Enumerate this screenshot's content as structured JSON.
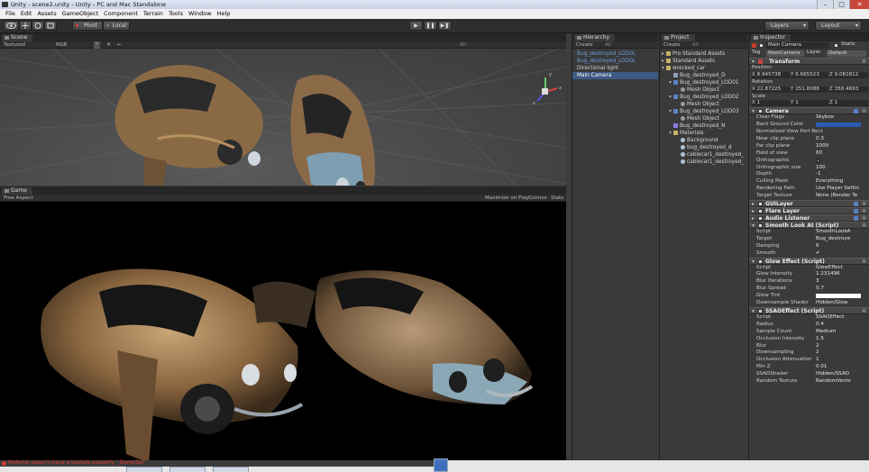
{
  "window": {
    "title": "Unity - scene2.unity - Unity - PC and Mac Standalone",
    "controls": [
      "–",
      "□",
      "✕"
    ]
  },
  "menu": [
    "File",
    "Edit",
    "Assets",
    "GameObject",
    "Component",
    "Terrain",
    "Tools",
    "Window",
    "Help"
  ],
  "toolbar": {
    "pivot": "Pivot",
    "local": "Local",
    "layers": "Layers",
    "layout": "Layout",
    "play_icons": [
      "▶",
      "❚❚",
      "▶❚"
    ]
  },
  "scene": {
    "tab": "Scene",
    "textured": "Textured",
    "rgb": "RGB",
    "gizmo_labels": [
      "*",
      "☀",
      "←"
    ],
    "search": "All",
    "axis_labels": [
      "y",
      "x",
      "z"
    ]
  },
  "game": {
    "tab": "Game",
    "aspect": "Free Aspect",
    "options": [
      "Maximize on Play",
      "Gizmos",
      "Stats"
    ]
  },
  "hierarchy": {
    "tab": "Hierarchy",
    "create": "Create",
    "search": "All",
    "items": [
      {
        "label": "Bug_destroyed_LOD0L",
        "style": "blue"
      },
      {
        "label": "Bug_destroyed_LOD0L",
        "style": "blue"
      },
      {
        "label": "Directional light",
        "style": "normal"
      },
      {
        "label": "Main Camera",
        "style": "sel"
      }
    ]
  },
  "project": {
    "tab": "Project",
    "create": "Create",
    "search": "All",
    "items": [
      {
        "label": "Pro Standard Assets",
        "indent": 0,
        "fold": "▸",
        "icon": "folder"
      },
      {
        "label": "Standard Assets",
        "indent": 0,
        "fold": "▸",
        "icon": "folder"
      },
      {
        "label": "wrecked_car",
        "indent": 0,
        "fold": "▾",
        "icon": "folder"
      },
      {
        "label": "Bug_destroyed_D",
        "indent": 1,
        "fold": "",
        "icon": "texture"
      },
      {
        "label": "Bug_destroyed_LOD01",
        "indent": 1,
        "fold": "▾",
        "icon": "prefab"
      },
      {
        "label": "Mesh Object",
        "indent": 2,
        "fold": "",
        "icon": "mesh"
      },
      {
        "label": "Bug_destroyed_LOD02",
        "indent": 1,
        "fold": "▾",
        "icon": "prefab"
      },
      {
        "label": "Mesh Object",
        "indent": 2,
        "fold": "",
        "icon": "mesh"
      },
      {
        "label": "Bug_destroyed_LOD03",
        "indent": 1,
        "fold": "▾",
        "icon": "prefab"
      },
      {
        "label": "Mesh Object",
        "indent": 2,
        "fold": "",
        "icon": "mesh"
      },
      {
        "label": "Bug_destroyed_N",
        "indent": 1,
        "fold": "",
        "icon": "normal"
      },
      {
        "label": "Materials",
        "indent": 1,
        "fold": "▾",
        "icon": "folder"
      },
      {
        "label": "Background",
        "indent": 2,
        "fold": "",
        "icon": "material"
      },
      {
        "label": "bug_destroyed_d",
        "indent": 2,
        "fold": "",
        "icon": "material"
      },
      {
        "label": "cablecar1_destroyed_",
        "indent": 2,
        "fold": "",
        "icon": "material"
      },
      {
        "label": "cablecar1_destroyed_",
        "indent": 2,
        "fold": "",
        "icon": "material"
      }
    ]
  },
  "inspector": {
    "tab": "Inspector",
    "object_name": "Main Camera",
    "static_label": "Static",
    "tag_label": "Tag",
    "tag_value": "MainCamera",
    "layer_label": "Layer",
    "layer_value": "Default",
    "transform": {
      "title": "Transform",
      "position_label": "Position",
      "position": [
        "X 8.945738",
        "Y 6.665523",
        "Z 9.082812"
      ],
      "rotation_label": "Rotation",
      "rotation": [
        "X 22.87225",
        "Y 251.8088",
        "Z 358.4693"
      ],
      "scale_label": "Scale",
      "scale": [
        "X 1",
        "Y 1",
        "Z 1"
      ]
    },
    "camera": {
      "title": "Camera",
      "rows": [
        {
          "label": "Clear Flags",
          "value": "Skybox"
        },
        {
          "label": "Back Ground Color",
          "value": ""
        },
        {
          "label": "Normalized View Port Rect",
          "value": ""
        },
        {
          "label": "Near clip plane",
          "value": "0.3"
        },
        {
          "label": "Far clip plane",
          "value": "1000"
        },
        {
          "label": "Field of view",
          "value": "60"
        },
        {
          "label": "Orthographic",
          "value": ""
        },
        {
          "label": "Orthographic size",
          "value": "100"
        },
        {
          "label": "Depth",
          "value": "-1"
        },
        {
          "label": "Culling Mask",
          "value": "Everything"
        },
        {
          "label": "Rendering Path",
          "value": "Use Player Settin"
        },
        {
          "label": "Target Texture",
          "value": "None (Render Te"
        }
      ],
      "bg_color": "#2a5db0"
    },
    "gui_layer": "GUILayer",
    "flare_layer": "Flare Layer",
    "audio_listener": "Audio Listener",
    "smooth_look": {
      "title": "Smooth Look At (Script)",
      "rows": [
        {
          "label": "Script",
          "value": "SmoothLookA"
        },
        {
          "label": "Target",
          "value": "Bug_destroye"
        },
        {
          "label": "Damping",
          "value": "6"
        },
        {
          "label": "Smooth",
          "value": "✔"
        }
      ]
    },
    "glow": {
      "title": "Glow Effect (Script)",
      "rows": [
        {
          "label": "Script",
          "value": "GlowEffect"
        },
        {
          "label": "Glow Intensity",
          "value": "1.231496"
        },
        {
          "label": "Blur Iterations",
          "value": "3"
        },
        {
          "label": "Blur Spread",
          "value": "0.7"
        },
        {
          "label": "Glow Tint",
          "value": ""
        },
        {
          "label": "Downsample Shader",
          "value": "Hidden/Glow"
        }
      ]
    },
    "ssao": {
      "title": "SSAOEffect (Script)",
      "rows": [
        {
          "label": "Script",
          "value": "SSAOEffect"
        },
        {
          "label": "Radius",
          "value": "0.4"
        },
        {
          "label": "Sample Count",
          "value": "Medium"
        },
        {
          "label": "Occlusion Intensity",
          "value": "1.5"
        },
        {
          "label": "Blur",
          "value": "2"
        },
        {
          "label": "Downsampling",
          "value": "2"
        },
        {
          "label": "Occlusion Attenuation",
          "value": "1"
        },
        {
          "label": "Min Z",
          "value": "0.01"
        },
        {
          "label": "SSAOShader",
          "value": "Hidden/SSAO"
        },
        {
          "label": "Random Texture",
          "value": "RandomVecto"
        }
      ]
    }
  },
  "status": {
    "message": "Material doesn't have a texture property '_BumpTex'"
  }
}
